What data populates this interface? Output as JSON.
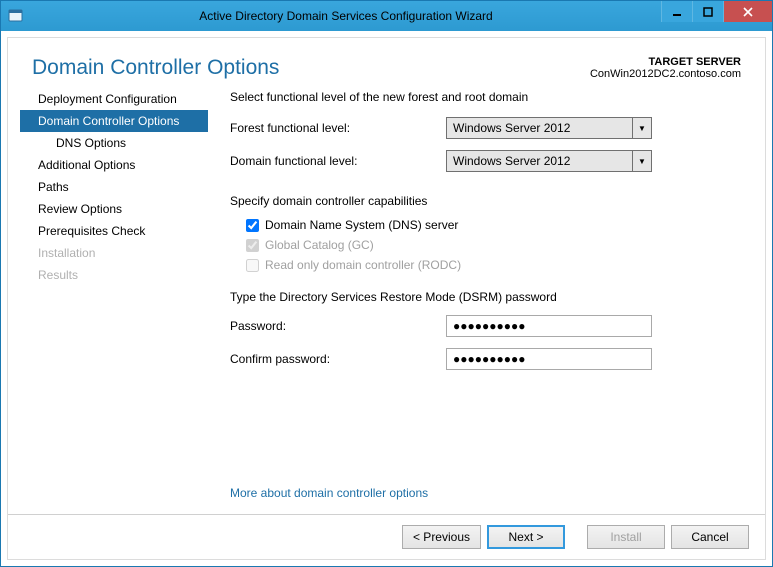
{
  "window": {
    "title": "Active Directory Domain Services Configuration Wizard"
  },
  "header": {
    "page_title": "Domain Controller Options",
    "target_label": "TARGET SERVER",
    "target_value": "ConWin2012DC2.contoso.com"
  },
  "sidebar": {
    "items": [
      {
        "label": "Deployment Configuration",
        "state": "normal"
      },
      {
        "label": "Domain Controller Options",
        "state": "selected"
      },
      {
        "label": "DNS Options",
        "state": "normal",
        "indent": true
      },
      {
        "label": "Additional Options",
        "state": "normal"
      },
      {
        "label": "Paths",
        "state": "normal"
      },
      {
        "label": "Review Options",
        "state": "normal"
      },
      {
        "label": "Prerequisites Check",
        "state": "normal"
      },
      {
        "label": "Installation",
        "state": "disabled"
      },
      {
        "label": "Results",
        "state": "disabled"
      }
    ]
  },
  "main": {
    "functional_lead": "Select functional level of the new forest and root domain",
    "forest_label": "Forest functional level:",
    "forest_value": "Windows Server 2012",
    "domain_label": "Domain functional level:",
    "domain_value": "Windows Server 2012",
    "capabilities_lead": "Specify domain controller capabilities",
    "cb_dns": "Domain Name System (DNS) server",
    "cb_gc": "Global Catalog (GC)",
    "cb_rodc": "Read only domain controller (RODC)",
    "dsrm_lead": "Type the Directory Services Restore Mode (DSRM) password",
    "password_label": "Password:",
    "password_value": "●●●●●●●●●●",
    "confirm_label": "Confirm password:",
    "confirm_value": "●●●●●●●●●●",
    "help_link": "More about domain controller options"
  },
  "footer": {
    "previous": "< Previous",
    "next": "Next >",
    "install": "Install",
    "cancel": "Cancel"
  }
}
